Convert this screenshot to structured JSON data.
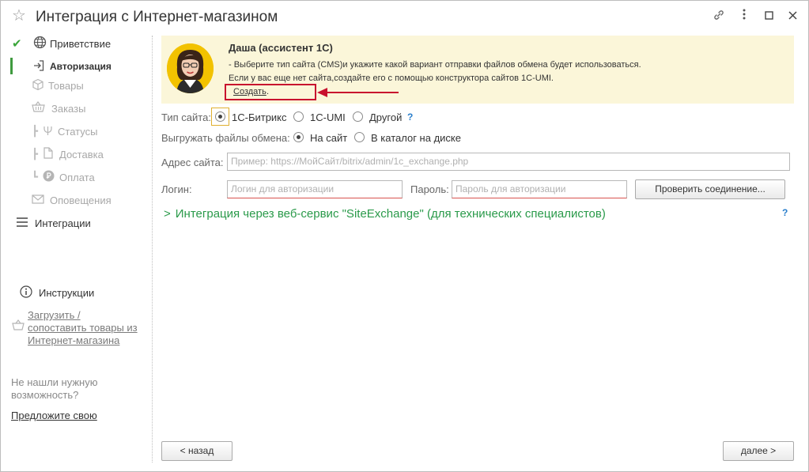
{
  "window": {
    "title": "Интеграция с Интернет-магазином"
  },
  "sidebar": {
    "items": [
      {
        "label": "Приветствие",
        "icon": "globe-icon",
        "state": "done"
      },
      {
        "label": "Авторизация",
        "icon": "login-icon",
        "state": "active"
      },
      {
        "label": "Товары",
        "icon": "box-icon",
        "state": "disabled"
      },
      {
        "label": "Заказы",
        "icon": "basket-icon",
        "state": "disabled"
      },
      {
        "label": "Статусы",
        "icon": "status-icon",
        "state": "disabled"
      },
      {
        "label": "Доставка",
        "icon": "delivery-icon",
        "state": "disabled"
      },
      {
        "label": "Оплата",
        "icon": "payment-icon",
        "state": "disabled"
      },
      {
        "label": "Оповещения",
        "icon": "mail-icon",
        "state": "disabled"
      },
      {
        "label": "Интеграции",
        "icon": "menu-icon",
        "state": "normal"
      }
    ],
    "instructions_label": "Инструкции",
    "load_link": [
      "Загрузить /",
      "сопоставить товары из",
      "Интернет-магазина"
    ],
    "not_found_text": [
      "Не нашли нужную",
      "возможность?"
    ],
    "suggest_link": "Предложите свою"
  },
  "assistant": {
    "name": "Даша (ассистент 1С)",
    "line1": "- Выберите тип сайта (CMS)и укажите какой вариант отправки файлов обмена будет использоваться.",
    "line2": "Если у вас еще нет сайта,создайте его с помощью конструктора сайтов 1С-UMI.",
    "create_link": "Создать",
    "create_suffix": "."
  },
  "form": {
    "site_type_label": "Тип сайта:",
    "site_types": [
      "1С-Битрикс",
      "1С-UMI",
      "Другой"
    ],
    "site_type_selected": "1С-Битрикс",
    "help_mark": "?",
    "upload_label": "Выгружать файлы обмена:",
    "upload_options": [
      "На сайт",
      "В каталог на диске"
    ],
    "upload_selected": "На сайт",
    "address_label": "Адрес сайта:",
    "address_placeholder": "Пример: https://МойСайт/bitrix/admin/1c_exchange.php",
    "login_label": "Логин:",
    "login_placeholder": "Логин для авторизации",
    "password_label": "Пароль:",
    "password_placeholder": "Пароль для авторизации",
    "check_button": "Проверить соединение...",
    "section_chevron": ">",
    "section_title": "Интеграция через веб-сервис \"SiteExchange\" (для технических специалистов)"
  },
  "footer": {
    "back_button": "< назад",
    "next_button": "далее >"
  },
  "colors": {
    "accent_green": "#2a9a4a",
    "assistant_bg": "#fbf6d9",
    "highlight_red": "#c8102e",
    "help_blue": "#2a7fcc"
  }
}
